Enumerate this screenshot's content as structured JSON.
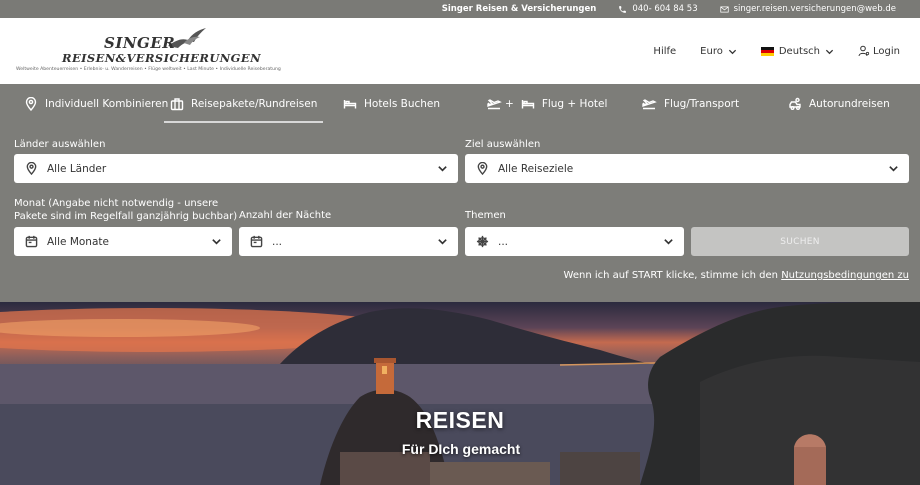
{
  "topbar": {
    "brand": "Singer Reisen & Versicherungen",
    "phone": "040- 604 84 53",
    "email": "singer.reisen.versicherungen@web.de"
  },
  "logo": {
    "line1": "SINGER",
    "line2": "REISEN&VERSICHERUNGEN",
    "tagline": "Weltweite Abenteuerreisen • Erlebnis- u. Wanderreisen • Flüge weltweit • Last Minute • Individuelle Reiseberatung"
  },
  "header_nav": {
    "help": "Hilfe",
    "currency": "Euro",
    "language": "Deutsch",
    "login": "Login"
  },
  "tabs": [
    {
      "label": "Individuell Kombinieren",
      "icon": "location-pin-icon"
    },
    {
      "label": "Reisepakete/Rundreisen",
      "icon": "suitcase-icon",
      "active": true
    },
    {
      "label": "Hotels Buchen",
      "icon": "bed-icon"
    },
    {
      "label": "Flug + Hotel",
      "icon": "plane-bed-icon"
    },
    {
      "label": "Flug/Transport",
      "icon": "plane-icon"
    },
    {
      "label": "Autorundreisen",
      "icon": "car-icon"
    }
  ],
  "form": {
    "countries_label": "Länder auswählen",
    "countries_value": "Alle Länder",
    "destination_label": "Ziel auswählen",
    "destination_value": "Alle Reiseziele",
    "month_label_line1": "Monat (Angabe nicht notwendig - unsere",
    "month_label_line2": "Pakete sind im Regelfall ganzjährig buchbar)",
    "month_value": "Alle Monate",
    "nights_label": "Anzahl der Nächte",
    "nights_value": "...",
    "themes_label": "Themen",
    "themes_value": "...",
    "submit": "SUCHEN",
    "terms_prefix": "Wenn ich auf START klicke, stimme ich den",
    "terms_link": "Nutzungsbedingungen zu"
  },
  "hero": {
    "title": "REISEN",
    "subtitle": "Für DIch gemacht"
  },
  "colors": {
    "panel": "#7d7d79",
    "topbar": "#7a7a76",
    "submit_disabled": "#c4c4c2"
  }
}
